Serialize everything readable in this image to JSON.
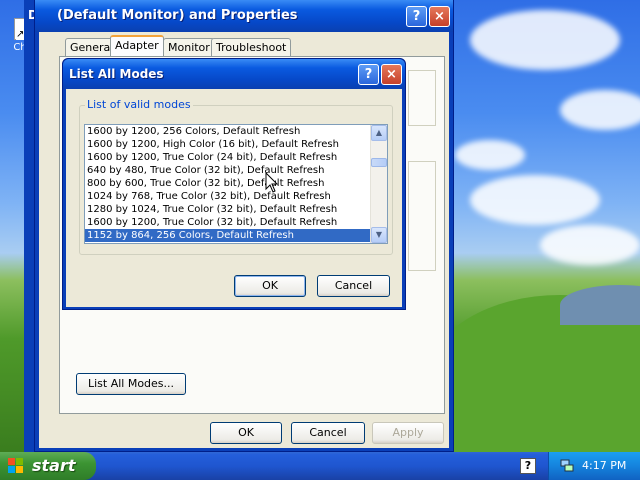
{
  "desktop": {
    "icon_label": "Chro"
  },
  "background_window": {
    "title_fragment": "D"
  },
  "properties_window": {
    "title": "(Default Monitor) and  Properties",
    "help_button": "?",
    "close_button": "×",
    "tabs": [
      {
        "label": "General",
        "active": false
      },
      {
        "label": "Adapter",
        "active": true
      },
      {
        "label": "Monitor",
        "active": false
      },
      {
        "label": "Troubleshoot",
        "active": false
      }
    ],
    "list_all_modes_button": "List All Modes...",
    "ok_button": "OK",
    "cancel_button": "Cancel",
    "apply_button": "Apply"
  },
  "modes_dialog": {
    "title": "List All Modes",
    "help_button": "?",
    "close_button": "×",
    "group_label": "List of valid modes",
    "modes": [
      "1600 by 1200, 256 Colors, Default Refresh",
      "1600 by 1200, High Color (16 bit), Default Refresh",
      "1600 by 1200, True Color (24 bit), Default Refresh",
      "640 by 480, True Color (32 bit), Default Refresh",
      "800 by 600, True Color (32 bit), Default Refresh",
      "1024 by 768, True Color (32 bit), Default Refresh",
      "1280 by 1024, True Color (32 bit), Default Refresh",
      "1600 by 1200, True Color (32 bit), Default Refresh",
      "1152 by 864, 256 Colors, Default Refresh"
    ],
    "selected_index": 8,
    "ok_button": "OK",
    "cancel_button": "Cancel"
  },
  "taskbar": {
    "start_label": "start",
    "help_icon_glyph": "?",
    "clock": "4:17 PM"
  },
  "colors": {
    "selection": "#316ac5",
    "xp_blue": "#0a3fb8",
    "dialog_face": "#ece9d8"
  }
}
